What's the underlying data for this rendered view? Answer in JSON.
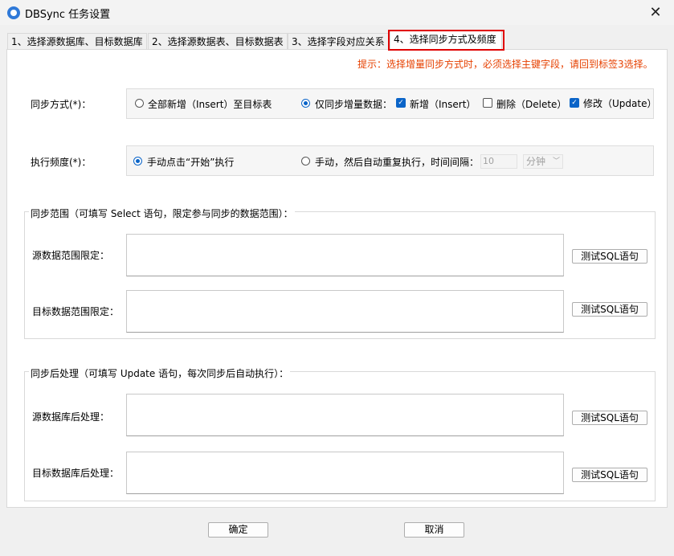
{
  "window": {
    "title": "DBSync 任务设置",
    "close_label": "✕"
  },
  "tabs": [
    {
      "label": "1、选择源数据库、目标数据库"
    },
    {
      "label": "2、选择源数据表、目标数据表"
    },
    {
      "label": "3、选择字段对应关系"
    },
    {
      "label": "4、选择同步方式及频度",
      "active": true
    }
  ],
  "hint": "提示：选择增量同步方式时，必须选择主键字段，请回到标签3选择。",
  "sync_mode": {
    "label": "同步方式(*)：",
    "option_full": "全部新增（Insert）至目标表",
    "option_incremental": "仅同步增量数据：",
    "selected": "incremental",
    "insert_label": "新增（Insert）",
    "insert_checked": true,
    "delete_label": "删除（Delete）",
    "delete_checked": false,
    "update_label": "修改（Update）",
    "update_checked": true
  },
  "frequency": {
    "label": "执行频度(*)：",
    "option_manual": "手动点击“开始”执行",
    "option_auto": "手动，然后自动重复执行，时间间隔：",
    "selected": "manual",
    "interval_value": "10",
    "unit_value": "分钟"
  },
  "sync_scope": {
    "title": "同步范围（可填写 Select 语句，限定参与同步的数据范围）：",
    "source_label": "源数据范围限定：",
    "target_label": "目标数据范围限定：",
    "source_value": "",
    "target_value": ""
  },
  "post_process": {
    "title": "同步后处理（可填写 Update 语句，每次同步后自动执行）：",
    "source_label": "源数据库后处理：",
    "target_label": "目标数据库后处理：",
    "source_value": "",
    "target_value": ""
  },
  "test_sql_label": "测试SQL语句",
  "buttons": {
    "ok": "确定",
    "cancel": "取消"
  },
  "colors": {
    "accent": "#0a64c8",
    "hint": "#e64000",
    "highlight": "#e00000"
  }
}
